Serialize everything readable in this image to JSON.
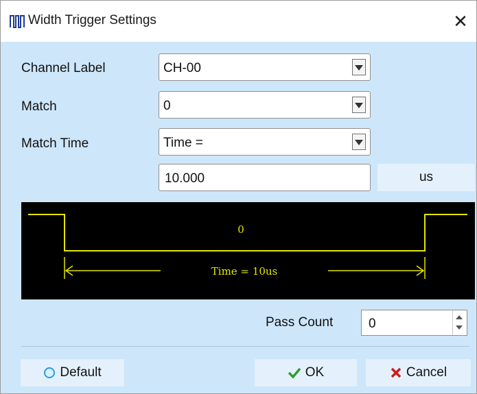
{
  "window": {
    "title": "Width Trigger Settings",
    "title_icon": "pulse-waveform-icon",
    "close_icon": "close-icon",
    "close_glyph": "✕"
  },
  "form": {
    "channel_label": {
      "label": "Channel Label",
      "value": "CH-00"
    },
    "match": {
      "label": "Match",
      "value": "0"
    },
    "match_time": {
      "label": "Match Time",
      "value": "Time ="
    },
    "time_value": "10.000",
    "unit_button": "us"
  },
  "preview": {
    "level_label": "0",
    "time_label": "Time = 10us",
    "waveform_color": "#e6e600",
    "background": "#000000"
  },
  "pass_count": {
    "label": "Pass Count",
    "value": "0"
  },
  "buttons": {
    "default": {
      "label": "Default",
      "icon": "circle-icon"
    },
    "ok": {
      "label": "OK",
      "icon": "check-icon"
    },
    "cancel": {
      "label": "Cancel",
      "icon": "x-icon"
    }
  },
  "colors": {
    "dialog_bg": "#cde6fa",
    "button_bg": "#e4f1fc",
    "ok_green": "#2e9e2e",
    "cancel_red": "#d11a1a"
  }
}
